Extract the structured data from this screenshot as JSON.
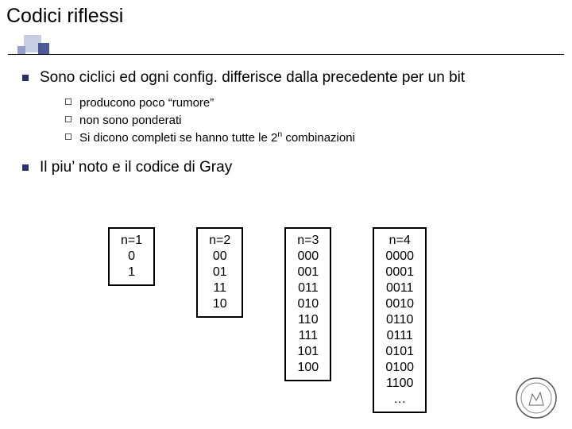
{
  "title": "Codici riflessi",
  "points": [
    {
      "text": "Sono ciclici ed ogni config. differisce dalla precedente per un bit",
      "sub": [
        "producono poco “rumore”",
        "non sono ponderati",
        "Si dicono completi se hanno tutte le 2^n combinazioni"
      ]
    },
    {
      "text": "Il piu’ noto e il codice di Gray",
      "sub": []
    }
  ],
  "codes": [
    {
      "header": "n=1",
      "values": [
        "0",
        "1"
      ]
    },
    {
      "header": "n=2",
      "values": [
        "00",
        "01",
        "11",
        "10"
      ]
    },
    {
      "header": "n=3",
      "values": [
        "000",
        "001",
        "011",
        "010",
        "110",
        "111",
        "101",
        "100"
      ]
    },
    {
      "header": "n=4",
      "values": [
        "0000",
        "0001",
        "0011",
        "0010",
        "0110",
        "0111",
        "0101",
        "0100",
        "1100",
        "…"
      ]
    }
  ]
}
